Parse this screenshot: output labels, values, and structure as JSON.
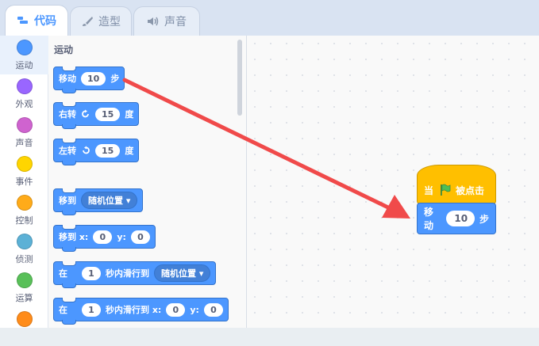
{
  "tabs": [
    {
      "label": "代码",
      "icon": "code-icon",
      "active": true
    },
    {
      "label": "造型",
      "icon": "brush-icon",
      "active": false
    },
    {
      "label": "声音",
      "icon": "speaker-icon",
      "active": false
    }
  ],
  "categories": [
    {
      "label": "运动",
      "color": "#4c97ff"
    },
    {
      "label": "外观",
      "color": "#9966ff"
    },
    {
      "label": "声音",
      "color": "#cf63cf"
    },
    {
      "label": "事件",
      "color": "#ffd500"
    },
    {
      "label": "控制",
      "color": "#ffab19"
    },
    {
      "label": "侦测",
      "color": "#5cb1d6"
    },
    {
      "label": "运算",
      "color": "#59c059"
    },
    {
      "label": "",
      "color": "#ff8c1a"
    }
  ],
  "palette": {
    "title": "运动",
    "move": {
      "label": "移动",
      "steps": "10",
      "unit": "步"
    },
    "turn_right": {
      "label": "右转",
      "degrees": "15",
      "unit": "度"
    },
    "turn_left": {
      "label": "左转",
      "degrees": "15",
      "unit": "度"
    },
    "goto": {
      "label": "移到",
      "target": "随机位置"
    },
    "goto_xy": {
      "label": "移到 x:",
      "x": "0",
      "ylabel": "y:",
      "y": "0"
    },
    "glide_to": {
      "prefix": "在",
      "secs": "1",
      "mid": "秒内滑行到",
      "target": "随机位置"
    },
    "glide_xy": {
      "prefix": "在",
      "secs": "1",
      "mid": "秒内滑行到 x:",
      "x": "0",
      "ylabel": "y:",
      "y": "0"
    }
  },
  "workspace": {
    "hat": {
      "prefix": "当",
      "suffix": "被点击"
    },
    "move": {
      "label": "移动",
      "steps": "10",
      "unit": "步"
    }
  },
  "colors": {
    "motion": "#4c97ff",
    "events": "#ffbf00",
    "arrow": "#f04a4a",
    "flag": "#4cbf56"
  }
}
